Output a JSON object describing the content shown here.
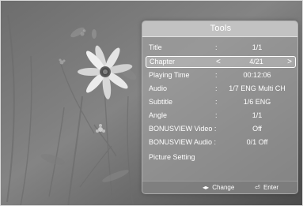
{
  "panel": {
    "title": "Tools",
    "rows": [
      {
        "label": "Title",
        "value": "1/1"
      },
      {
        "label": "Chapter",
        "value": "4/21"
      },
      {
        "label": "Playing Time",
        "value": "00:12:06"
      },
      {
        "label": "Audio",
        "value": "1/7 ENG Multi CH"
      },
      {
        "label": "Subtitle",
        "value": "1/6 ENG"
      },
      {
        "label": "Angle",
        "value": "1/1"
      },
      {
        "label": "BONUSVIEW Video :",
        "value": "Off"
      },
      {
        "label": "BONUSVIEW Audio :",
        "value": "0/1 Off"
      },
      {
        "label": "Picture Setting",
        "value": ""
      }
    ],
    "colon": ":",
    "chapter_left": "<",
    "chapter_right": ">",
    "footer": {
      "change_icon": "left-right-arrows-icon",
      "change_glyph": "◂▸",
      "change_label": "Change",
      "enter_icon": "enter-icon",
      "enter_glyph": "⏎",
      "enter_label": "Enter"
    }
  }
}
